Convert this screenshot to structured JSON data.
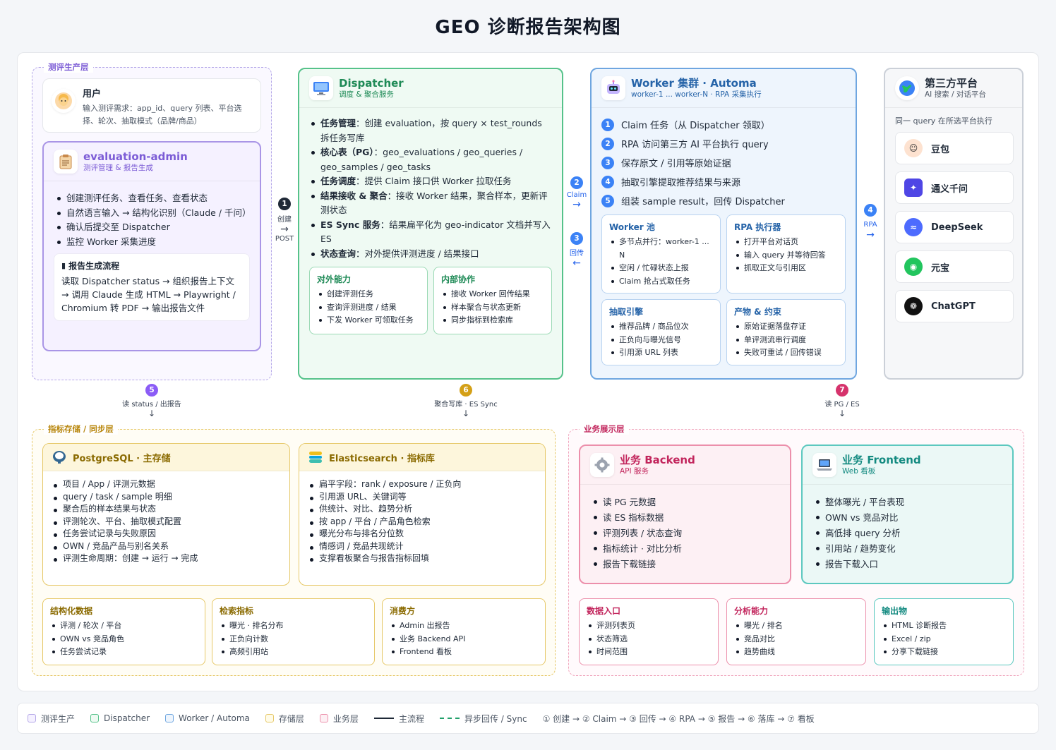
{
  "title": "GEO 诊断报告架构图",
  "zones": {
    "eval": "测评生产层",
    "storage": "指标存储 / 同步层",
    "biz": "业务展示层"
  },
  "user": {
    "title": "用户",
    "desc": "输入测评需求：app_id、query 列表、平台选择、轮次、抽取模式（品牌/商品）"
  },
  "admin": {
    "title": "evaluation-admin",
    "subtitle": "测评管理 & 报告生成",
    "items": [
      "创建测评任务、查看任务、查看状态",
      "自然语言输入 → 结构化识别（Claude / 千问）",
      "确认后提交至 Dispatcher",
      "监控 Worker 采集进度"
    ],
    "flow_title": "报告生成流程",
    "flow_text": "读取 Dispatcher status → 组织报告上下文 → 调用 Claude 生成 HTML → Playwright / Chromium 转 PDF → 输出报告文件"
  },
  "dispatcher": {
    "title": "Dispatcher",
    "subtitle": "调度 & 聚合服务",
    "items": [
      {
        "k": "任务管理",
        "v": "：创建 evaluation，按 query × test_rounds 拆任务写库"
      },
      {
        "k": "核心表（PG）",
        "v": "：geo_evaluations / geo_queries / geo_samples / geo_tasks"
      },
      {
        "k": "任务调度",
        "v": "：提供 Claim 接口供 Worker 拉取任务"
      },
      {
        "k": "结果接收 & 聚合",
        "v": "：接收 Worker 结果，聚合样本，更新评测状态"
      },
      {
        "k": "ES Sync 服务",
        "v": "：结果扁平化为 geo-indicator 文档并写入 ES"
      },
      {
        "k": "状态查询",
        "v": "：对外提供评测进度 / 结果接口"
      }
    ],
    "ext_title": "对外能力",
    "ext": [
      "创建评测任务",
      "查询评测进度 / 结果",
      "下发 Worker 可领取任务"
    ],
    "int_title": "内部协作",
    "int": [
      "接收 Worker 回传结果",
      "样本聚合与状态更新",
      "同步指标到检索库"
    ]
  },
  "worker": {
    "title": "Worker 集群 · Automa",
    "subtitle": "worker-1 ... worker-N · RPA 采集执行",
    "steps": [
      "Claim 任务（从 Dispatcher 领取）",
      "RPA 访问第三方 AI 平台执行 query",
      "保存原文 / 引用等原始证据",
      "抽取引擎提取推荐结果与来源",
      "组装 sample result，回传 Dispatcher"
    ],
    "pool_title": "Worker 池",
    "pool": [
      "多节点并行：worker-1 ... N",
      "空闲 / 忙碌状态上报",
      "Claim 抢占式取任务"
    ],
    "rpa_title": "RPA 执行器",
    "rpa": [
      "打开平台对话页",
      "输入 query 并等待回答",
      "抓取正文与引用区"
    ],
    "extract_title": "抽取引擎",
    "extract": [
      "推荐品牌 / 商品位次",
      "正负向与曝光信号",
      "引用源 URL 列表"
    ],
    "output_title": "产物 & 约束",
    "output": [
      "原始证据落盘存证",
      "单评测流串行调度",
      "失败可重试 / 回传错误"
    ]
  },
  "third": {
    "title": "第三方平台",
    "subtitle": "AI 搜索 / 对话平台",
    "note": "同一 query 在所选平台执行",
    "platforms": [
      "豆包",
      "通义千问",
      "DeepSeek",
      "元宝",
      "ChatGPT"
    ]
  },
  "connectors": {
    "c1_num": "1",
    "c1_a": "创建",
    "c1_b": "POST",
    "c2_num": "2",
    "c2_a": "Claim",
    "c3_num": "3",
    "c3_a": "回传",
    "c4_num": "4",
    "c4_a": "RPA",
    "c5_num": "5",
    "c5_a": "读 status / 出报告",
    "c6_num": "6",
    "c6_a": "聚合写库 · ES Sync",
    "c7_num": "7",
    "c7_a": "读 PG / ES"
  },
  "pg": {
    "title": "PostgreSQL · 主存储",
    "items": [
      "项目 / App / 评测元数据",
      "query / task / sample 明细",
      "聚合后的样本结果与状态",
      "评测轮次、平台、抽取模式配置",
      "任务尝试记录与失败原因",
      "OWN / 竞品产品与别名关系",
      "评测生命周期：创建 → 运行 → 完成"
    ]
  },
  "es": {
    "title": "Elasticsearch · 指标库",
    "items": [
      "扁平字段：rank / exposure / 正负向",
      "引用源 URL、关键词等",
      "供统计、对比、趋势分析",
      "按 app / 平台 / 产品角色检索",
      "曝光分布与排名分位数",
      "情感词 / 竞品共现统计",
      "支撑看板聚合与报告指标回填"
    ]
  },
  "storage_subs": [
    {
      "title": "结构化数据",
      "items": [
        "评测 / 轮次 / 平台",
        "OWN vs 竞品角色",
        "任务尝试记录"
      ]
    },
    {
      "title": "检索指标",
      "items": [
        "曝光 · 排名分布",
        "正负向计数",
        "高频引用站"
      ]
    },
    {
      "title": "消费方",
      "items": [
        "Admin 出报告",
        "业务 Backend API",
        "Frontend 看板"
      ]
    }
  ],
  "backend": {
    "title": "业务 Backend",
    "subtitle": "API 服务",
    "items": [
      "读 PG 元数据",
      "读 ES 指标数据",
      "评测列表 / 状态查询",
      "指标统计 · 对比分析",
      "报告下载链接"
    ]
  },
  "frontend": {
    "title": "业务 Frontend",
    "subtitle": "Web 看板",
    "items": [
      "整体曝光 / 平台表现",
      "OWN vs 竞品对比",
      "高低排 query 分析",
      "引用站 / 趋势变化",
      "报告下载入口"
    ]
  },
  "biz_subs": [
    {
      "title": "数据入口",
      "items": [
        "评测列表页",
        "状态筛选",
        "时间范围"
      ]
    },
    {
      "title": "分析能力",
      "items": [
        "曝光 / 排名",
        "竞品对比",
        "趋势曲线"
      ]
    },
    {
      "title": "输出物",
      "items": [
        "HTML 诊断报告",
        "Excel / zip",
        "分享下载链接"
      ]
    }
  ],
  "legend": {
    "l1": "测评生产",
    "l2": "Dispatcher",
    "l3": "Worker / Automa",
    "l4": "存储层",
    "l5": "业务层",
    "l6": "主流程",
    "l7": "异步回传 / Sync",
    "l8": "① 创建 → ② Claim → ③ 回传 → ④ RPA → ⑤ 报告 → ⑥ 落库 → ⑦ 看板"
  },
  "colors": {
    "purple": "#8b5cf6",
    "green": "#22a06b",
    "blue": "#4a90d9",
    "gray": "#9ca3af",
    "yellow": "#d4a017",
    "pink": "#e0577f",
    "teal": "#2bb3a8"
  }
}
